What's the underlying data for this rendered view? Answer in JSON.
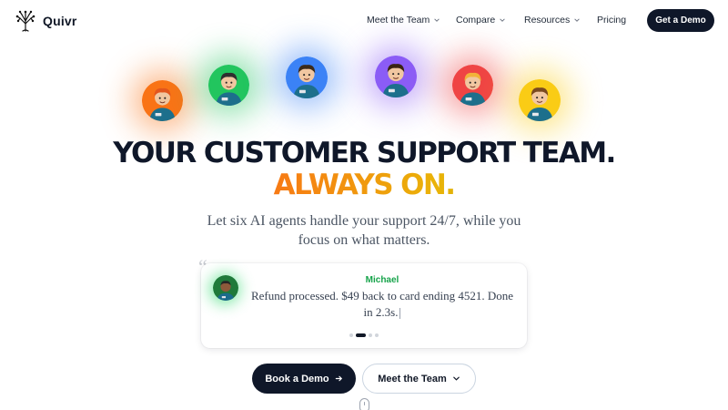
{
  "brand": {
    "name": "Quivr",
    "logo_icon": "tree-icon"
  },
  "nav": {
    "items": [
      {
        "label": "Meet the Team",
        "has_dropdown": true
      },
      {
        "label": "Compare",
        "has_dropdown": true
      },
      {
        "label": "Resources",
        "has_dropdown": true
      },
      {
        "label": "Pricing",
        "has_dropdown": false
      }
    ],
    "cta_label": "Get a Demo"
  },
  "agents": [
    {
      "name": "agent-1",
      "color": "#f97316",
      "hair": "#e2561d"
    },
    {
      "name": "agent-2",
      "color": "#22c55e",
      "hair": "#2f2f2f"
    },
    {
      "name": "agent-3",
      "color": "#3b82f6",
      "hair": "#3b2a1a"
    },
    {
      "name": "agent-4",
      "color": "#8b5cf6",
      "hair": "#3a2313"
    },
    {
      "name": "agent-5",
      "color": "#ef4444",
      "hair": "#f2b23a"
    },
    {
      "name": "agent-6",
      "color": "#facc15",
      "hair": "#7a4a1f"
    }
  ],
  "hero": {
    "headline_line1": "YOUR CUSTOMER SUPPORT TEAM.",
    "headline_line2": "ALWAYS ON.",
    "subtitle_line1": "Let six AI agents handle your support 24/7, while you",
    "subtitle_line2": "focus on what matters."
  },
  "testimonial": {
    "quote_mark": "“",
    "name": "Michael",
    "text": "Refund processed. $49 back to card ending 4521. Done in 2.3s.",
    "accent": "#16a34a",
    "dots": 4,
    "active_dot": 1
  },
  "cta": {
    "primary_label": "Book a Demo",
    "primary_icon": "arrow-right-icon",
    "secondary_label": "Meet the Team",
    "secondary_icon": "chevron-down-icon"
  },
  "colors": {
    "dark": "#0f1729",
    "accent_green": "#16a34a"
  }
}
